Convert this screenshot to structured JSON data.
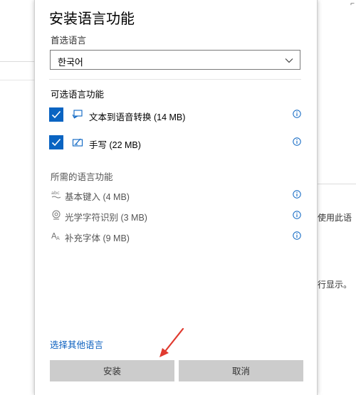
{
  "dialog": {
    "title": "安装语言功能",
    "preferred_label": "首选语言",
    "selected_language": "한국어",
    "optional_section": "可选语言功能",
    "optional_features": [
      {
        "label": "文本到语音转换 (14 MB)",
        "checked": true,
        "icon": "speech-icon"
      },
      {
        "label": "手写 (22 MB)",
        "checked": true,
        "icon": "handwriting-icon"
      }
    ],
    "required_section": "所需的语言功能",
    "required_features": [
      {
        "label": "基本键入 (4 MB)",
        "icon": "basic-typing-icon",
        "glyph": "abc"
      },
      {
        "label": "光学字符识别 (3 MB)",
        "icon": "ocr-icon",
        "glyph": ""
      },
      {
        "label": "补充字体 (9 MB)",
        "icon": "font-icon",
        "glyph": "A"
      }
    ],
    "other_language_link": "选择其他语言",
    "install_button": "安装",
    "cancel_button": "取消"
  },
  "background": {
    "text1": "使用此语",
    "text2": "行显示。"
  },
  "colors": {
    "accent": "#0a64c2",
    "link": "#0a5fbf",
    "button_bg": "#cccccc",
    "arrow": "#e03a2f"
  }
}
